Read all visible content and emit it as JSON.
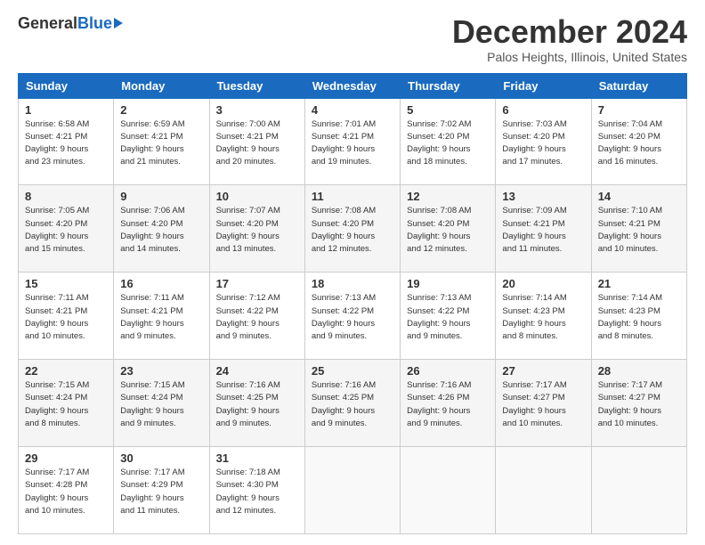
{
  "logo": {
    "general": "General",
    "blue": "Blue"
  },
  "title": "December 2024",
  "location": "Palos Heights, Illinois, United States",
  "headers": [
    "Sunday",
    "Monday",
    "Tuesday",
    "Wednesday",
    "Thursday",
    "Friday",
    "Saturday"
  ],
  "weeks": [
    [
      {
        "day": "1",
        "sunrise": "6:58 AM",
        "sunset": "4:21 PM",
        "daylight_h": "9",
        "daylight_m": "23"
      },
      {
        "day": "2",
        "sunrise": "6:59 AM",
        "sunset": "4:21 PM",
        "daylight_h": "9",
        "daylight_m": "21"
      },
      {
        "day": "3",
        "sunrise": "7:00 AM",
        "sunset": "4:21 PM",
        "daylight_h": "9",
        "daylight_m": "20"
      },
      {
        "day": "4",
        "sunrise": "7:01 AM",
        "sunset": "4:21 PM",
        "daylight_h": "9",
        "daylight_m": "19"
      },
      {
        "day": "5",
        "sunrise": "7:02 AM",
        "sunset": "4:20 PM",
        "daylight_h": "9",
        "daylight_m": "18"
      },
      {
        "day": "6",
        "sunrise": "7:03 AM",
        "sunset": "4:20 PM",
        "daylight_h": "9",
        "daylight_m": "17"
      },
      {
        "day": "7",
        "sunrise": "7:04 AM",
        "sunset": "4:20 PM",
        "daylight_h": "9",
        "daylight_m": "16"
      }
    ],
    [
      {
        "day": "8",
        "sunrise": "7:05 AM",
        "sunset": "4:20 PM",
        "daylight_h": "9",
        "daylight_m": "15"
      },
      {
        "day": "9",
        "sunrise": "7:06 AM",
        "sunset": "4:20 PM",
        "daylight_h": "9",
        "daylight_m": "14"
      },
      {
        "day": "10",
        "sunrise": "7:07 AM",
        "sunset": "4:20 PM",
        "daylight_h": "9",
        "daylight_m": "13"
      },
      {
        "day": "11",
        "sunrise": "7:08 AM",
        "sunset": "4:20 PM",
        "daylight_h": "9",
        "daylight_m": "12"
      },
      {
        "day": "12",
        "sunrise": "7:08 AM",
        "sunset": "4:20 PM",
        "daylight_h": "9",
        "daylight_m": "12"
      },
      {
        "day": "13",
        "sunrise": "7:09 AM",
        "sunset": "4:21 PM",
        "daylight_h": "9",
        "daylight_m": "11"
      },
      {
        "day": "14",
        "sunrise": "7:10 AM",
        "sunset": "4:21 PM",
        "daylight_h": "9",
        "daylight_m": "10"
      }
    ],
    [
      {
        "day": "15",
        "sunrise": "7:11 AM",
        "sunset": "4:21 PM",
        "daylight_h": "9",
        "daylight_m": "10"
      },
      {
        "day": "16",
        "sunrise": "7:11 AM",
        "sunset": "4:21 PM",
        "daylight_h": "9",
        "daylight_m": "9"
      },
      {
        "day": "17",
        "sunrise": "7:12 AM",
        "sunset": "4:22 PM",
        "daylight_h": "9",
        "daylight_m": "9"
      },
      {
        "day": "18",
        "sunrise": "7:13 AM",
        "sunset": "4:22 PM",
        "daylight_h": "9",
        "daylight_m": "9"
      },
      {
        "day": "19",
        "sunrise": "7:13 AM",
        "sunset": "4:22 PM",
        "daylight_h": "9",
        "daylight_m": "9"
      },
      {
        "day": "20",
        "sunrise": "7:14 AM",
        "sunset": "4:23 PM",
        "daylight_h": "9",
        "daylight_m": "8"
      },
      {
        "day": "21",
        "sunrise": "7:14 AM",
        "sunset": "4:23 PM",
        "daylight_h": "9",
        "daylight_m": "8"
      }
    ],
    [
      {
        "day": "22",
        "sunrise": "7:15 AM",
        "sunset": "4:24 PM",
        "daylight_h": "9",
        "daylight_m": "8"
      },
      {
        "day": "23",
        "sunrise": "7:15 AM",
        "sunset": "4:24 PM",
        "daylight_h": "9",
        "daylight_m": "9"
      },
      {
        "day": "24",
        "sunrise": "7:16 AM",
        "sunset": "4:25 PM",
        "daylight_h": "9",
        "daylight_m": "9"
      },
      {
        "day": "25",
        "sunrise": "7:16 AM",
        "sunset": "4:25 PM",
        "daylight_h": "9",
        "daylight_m": "9"
      },
      {
        "day": "26",
        "sunrise": "7:16 AM",
        "sunset": "4:26 PM",
        "daylight_h": "9",
        "daylight_m": "9"
      },
      {
        "day": "27",
        "sunrise": "7:17 AM",
        "sunset": "4:27 PM",
        "daylight_h": "9",
        "daylight_m": "10"
      },
      {
        "day": "28",
        "sunrise": "7:17 AM",
        "sunset": "4:27 PM",
        "daylight_h": "9",
        "daylight_m": "10"
      }
    ],
    [
      {
        "day": "29",
        "sunrise": "7:17 AM",
        "sunset": "4:28 PM",
        "daylight_h": "9",
        "daylight_m": "10"
      },
      {
        "day": "30",
        "sunrise": "7:17 AM",
        "sunset": "4:29 PM",
        "daylight_h": "9",
        "daylight_m": "11"
      },
      {
        "day": "31",
        "sunrise": "7:18 AM",
        "sunset": "4:30 PM",
        "daylight_h": "9",
        "daylight_m": "12"
      },
      null,
      null,
      null,
      null
    ]
  ],
  "labels": {
    "sunrise": "Sunrise:",
    "sunset": "Sunset:",
    "daylight": "Daylight:"
  }
}
